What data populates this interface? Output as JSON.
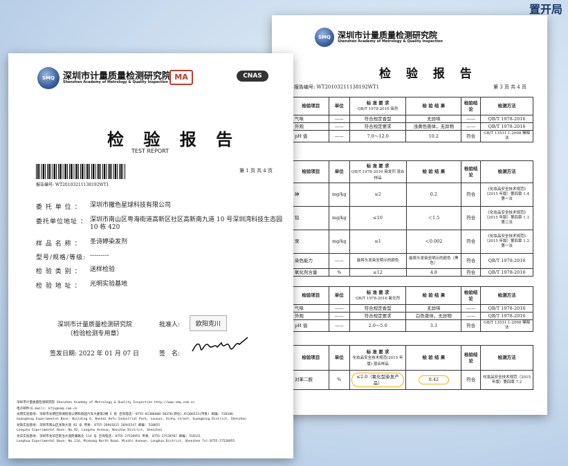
{
  "corner_text": "置开局",
  "back_page": {
    "org_cn": "深圳市计量质量检测研究院",
    "org_en": "Shenzhen Academy of Metrology & Quality Inspection",
    "logo_text": "SMQ",
    "title": "检 验 报 告",
    "report_no": "报告编号: WT20103211138192WT1",
    "page_label": "第 3 页 共 4 页",
    "table1": {
      "headers": [
        "检验项目",
        "单位",
        "标 准 要 求",
        "检 验 结 果",
        "检验结论",
        "检测方法"
      ],
      "std_sub": "QB/T 1978-2016 染剂",
      "rows": [
        [
          "气味",
          "——",
          "符合规定香型",
          "无异味",
          "——",
          "QB/T 1978-2016"
        ],
        [
          "外观",
          "——",
          "符合规定要求",
          "浅黄色膏体，无异物",
          "——",
          "QB/T 1978-2016"
        ],
        [
          "pH 值",
          "——",
          "7.0～12.0",
          "10.2",
          "符合",
          "GB/T 13531.1-2008 稀释法"
        ]
      ]
    },
    "table2": {
      "headers": [
        "检验项目",
        "单位",
        "标 准 要 求",
        "检 验 结 果",
        "检验结论",
        "检测方法"
      ],
      "std_sub": "QB/T 1978-2016 染发剂 混合样品",
      "rows": [
        [
          "砷",
          "mg/kg",
          "≤2",
          "0.2",
          "符合",
          "《化妆品安全技术规范》（2015 年版）第四章 1.4 第一法"
        ],
        [
          "铅",
          "mg/kg",
          "≤10",
          "＜1.5",
          "符合",
          "《化妆品安全技术规范》（2015 年版）第四章 1.3 第二法"
        ],
        [
          "汞",
          "mg/kg",
          "≤1",
          "＜0.002",
          "符合",
          "《化妆品安全技术规范》（2015 年版）第四章 1.2 第一法"
        ],
        [
          "染色能力",
          "——",
          "能将头发染至明示的颜色",
          "能将头发染至明示的颜色（黑色）",
          "符合",
          "QB/T 1978-2016"
        ],
        [
          "氧化剂含量",
          "%",
          "≤12",
          "4.8",
          "符合",
          "QB/T 1978-2016"
        ]
      ]
    },
    "table3": {
      "headers": [
        "检验项目",
        "单位",
        "标 准 要 求",
        "检 验 结 果",
        "检验结论",
        "检测方法"
      ],
      "std_sub": "QB/T 1978-2016 氧化剂",
      "rows": [
        [
          "气味",
          "——",
          "符合规定香型",
          "无异味",
          "——",
          "QB/T 1978-2016"
        ],
        [
          "外观",
          "——",
          "符合规定要求",
          "白色膏体，无异物",
          "——",
          "QB/T 1978-2016"
        ],
        [
          "pH 值",
          "——",
          "2.0～5.0",
          "3.3",
          "符合",
          "GB/T 13531.1-2008 稀释法"
        ]
      ]
    },
    "table4": {
      "headers": [
        "检验项目",
        "单位",
        "标 准 要 求",
        "检 验 结 果",
        "检验结论",
        "检测方法"
      ],
      "std_sub": "化妆品安全技术规范(2015 年版) 混合样品",
      "rows": [
        [
          "对苯二胺",
          "%",
          "≤2.0（氧化型染发产品）",
          "0.42",
          "符合",
          "化妆品安全技术规范（2015 年版）第四章 7.2"
        ]
      ]
    }
  },
  "front_page": {
    "org_cn": "深圳市计量质量检测研究院",
    "org_en": "Shenzhen Academy of Metrology & Quality Inspection",
    "logo_text": "SMQ",
    "ma_logo": "MA",
    "cnas_logo": "CNAS",
    "title": "检 验 报 告",
    "subtitle": "TEST REPORT",
    "report_no": "报告编号: WT20103211138192WT1",
    "page_label": "第 1 页 共 4 页",
    "fields": [
      {
        "label": "委 托 单 位 ：",
        "value": "深圳市撒色星球科技有限公司"
      },
      {
        "label": "委托单位地址 ：",
        "value": "深圳市南山区粤海街道高新区社区高新南九道 10 号深圳湾科技生态园 10 栋 420"
      },
      {
        "label": "样 品 名 称 ：",
        "value": "圣诗婷染发剂"
      },
      {
        "label": "型号/规格/等级:",
        "value": "---------"
      },
      {
        "label": "检 验 类 别 ：",
        "value": "送样检验"
      },
      {
        "label": "检 验 地 址 ：",
        "value": "光明实验基地"
      }
    ],
    "issuer_line1": "深圳市计量质量检测研究院",
    "issuer_line2": "（检验检测专用章）",
    "approver_label": "批准人:",
    "approver_name": "欧阳克川",
    "sign_date": "签发日期: 2022 年 01 月 07 日",
    "sign_label": "签　名:",
    "footer": [
      "深圳市计量质量检测研究院  Shenzhen Academy of Metrology & Quality Inspection  http://www.smq.com.cn",
      "电子邮件(E-mail): kfzx@smq.com.cn",
      "光明实验基地: 深圳市光明区新湖街道公明科技园汽车大厦第2楼 E 栋  咨询电话: 0755-81306600-50378(转化),81306523(传真)  邮编: 518106",
      "Guangming Experimental Base: Building 6, Banhai Kefu Industrial Park, Louxun, Xinhu street, Guangming District, Shenzhen",
      "龙珠实验基地: 深圳市南山区龙珠大道 92 号  传真: 0755-26941615  26941547  邮编: 518055",
      "Longzhu Experimental Base: No.92, Longzhu Avenue, Nanshan District, Shenzhen",
      "龙华实验基地: 深圳市龙华区民治大道民康路北 114 号  咨询电话: 0755-27520955  传真: 0755-27520707  邮编: 518131",
      "Longhua Experimental Base: No.114, Minkang North Road, Minzhi Avenue, Longhua District, Shenzhen Tel:0755-27520955"
    ]
  }
}
